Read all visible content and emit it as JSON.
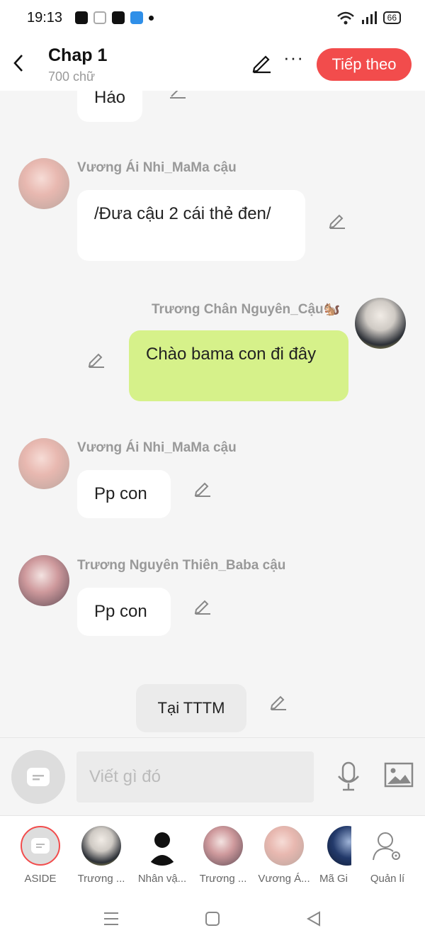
{
  "status_bar": {
    "time": "19:13",
    "battery": "66",
    "app_icons": [
      "zalo-icon",
      "gamepad-icon",
      "shopee-icon",
      "blue-app-icon",
      "dot-icon"
    ]
  },
  "header": {
    "title": "Chap 1",
    "subtitle": "700 chữ",
    "next_label": "Tiếp theo"
  },
  "messages": [
    {
      "side": "left",
      "text": "Háo"
    },
    {
      "side": "left",
      "sender": "Vương Ái Nhi_MaMa cậu",
      "text": "/Đưa cậu 2 cái thẻ đen/"
    },
    {
      "side": "right",
      "sender": "Trương Chân Nguyên_Cậu🐿️",
      "text": "Chào bama con đi đây"
    },
    {
      "side": "left",
      "sender": "Vương Ái Nhi_MaMa cậu",
      "text": "Pp con"
    },
    {
      "side": "left",
      "sender": "Trương Nguyên Thiên_Baba cậu",
      "text": "Pp con"
    },
    {
      "side": "center",
      "text": "Tại TTTM"
    }
  ],
  "composer": {
    "placeholder": "Viết gì đó"
  },
  "characters": [
    {
      "label": "ASIDE"
    },
    {
      "label": "Trương ..."
    },
    {
      "label": "Nhân vậ..."
    },
    {
      "label": "Trương ..."
    },
    {
      "label": "Vương Á..."
    },
    {
      "label": "Mã Gi"
    },
    {
      "label": "Quản lí"
    }
  ],
  "colors": {
    "accent": "#f24c4c",
    "right_bubble": "#d6f18a",
    "background": "#f5f5f5"
  }
}
